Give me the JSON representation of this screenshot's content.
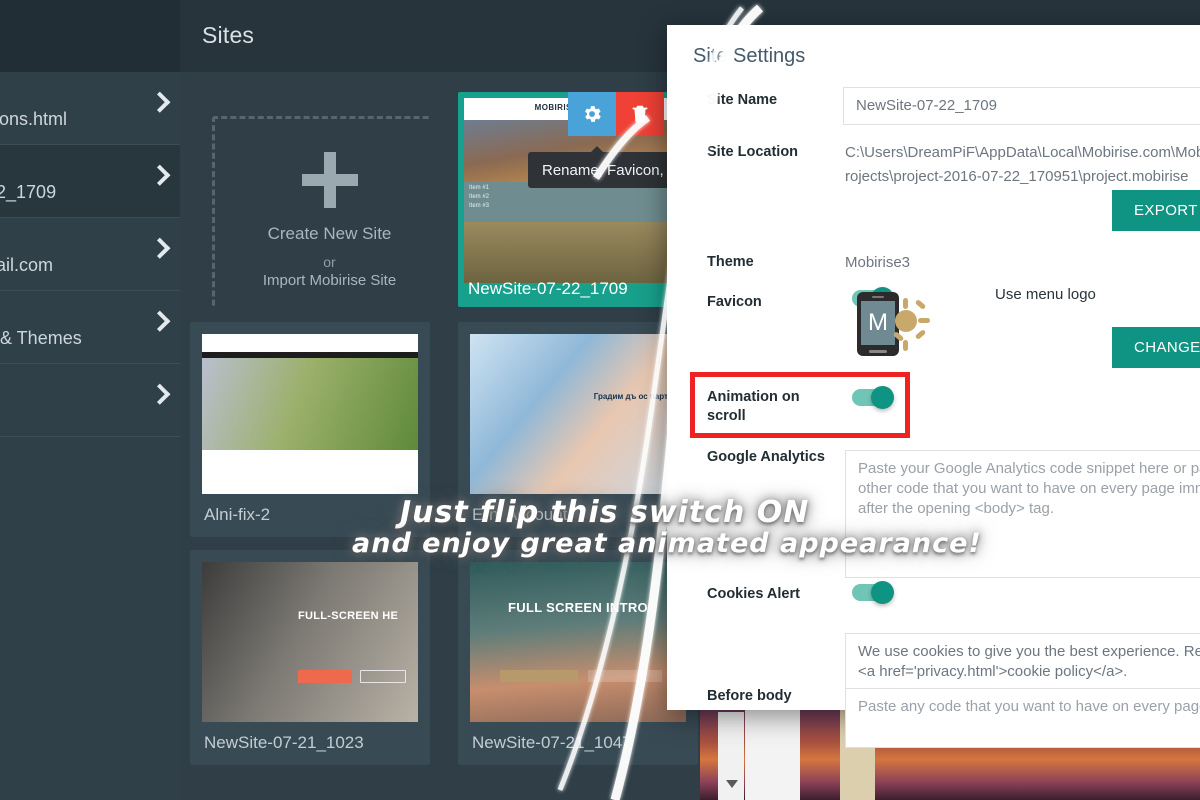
{
  "app": {
    "header_title": "Sites",
    "sidebar": {
      "items": [
        {
          "label": "icons.html",
          "icon": "chevron-right-icon",
          "active": false
        },
        {
          "label": "22_1709",
          "icon": "chevron-right-icon",
          "active": true
        },
        {
          "label": "nail.com",
          "icon": "chevron-right-icon",
          "active": false
        },
        {
          "label": "s & Themes",
          "icon": "chevron-right-icon",
          "active": false
        },
        {
          "label": "",
          "icon": "chevron-right-icon",
          "active": false
        }
      ]
    },
    "new_site": {
      "plus_icon": "plus-icon",
      "create_label": "Create New Site",
      "or_label": "or",
      "import_label": "Import Mobirise Site"
    },
    "tooltip": "Rename, Favicon, E",
    "card_actions": {
      "settings_icon": "gear-icon",
      "delete_icon": "trash-icon"
    },
    "cards": [
      {
        "caption": "NewSite-07-22_1709",
        "selected": true,
        "thumb_text": "MOBIRISE GIVES YO",
        "menu": [
          "Item #1",
          "Item #2",
          "Item #3"
        ]
      },
      {
        "caption": "Alni-fix-2",
        "selected": false,
        "thumb_text": ""
      },
      {
        "caption": "Erni Account",
        "selected": false,
        "thumb_text": "Градим дъ ос парт ьо"
      },
      {
        "caption": "NewSite-07-21_1023",
        "selected": false,
        "thumb_text": "FULL-SCREEN HE"
      },
      {
        "caption": "NewSite-07-21_1047",
        "selected": false,
        "thumb_text": "FULL SCREEN INTRO"
      }
    ]
  },
  "dialog": {
    "title": "Site Settings",
    "site_name": {
      "label": "Site Name",
      "value": "NewSite-07-22_1709"
    },
    "site_location": {
      "label": "Site Location",
      "line1": "C:\\Users\\DreamPiF\\AppData\\Local\\Mobirise.com\\Mobiri",
      "line2": "rojects\\project-2016-07-22_170951\\project.mobirise",
      "export_button": "EXPORT SIT"
    },
    "theme": {
      "label": "Theme",
      "value": "Mobirise3"
    },
    "favicon": {
      "label": "Favicon",
      "art_icon": "phone-favicon-icon",
      "art_letter": "M",
      "use_menu_logo_label": "Use menu logo",
      "use_menu_logo_on": true,
      "change_button": "CHANGE FAVICO"
    },
    "animation_on_scroll": {
      "label_line1": "Animation on",
      "label_line2": "scroll",
      "enabled": true,
      "highlight_color": "#ee2222"
    },
    "google_analytics": {
      "label": "Google Analytics",
      "placeholder": "Paste your Google Analytics code snippet here or paste any other code that you want to have on every page immediately after the opening <body> tag."
    },
    "cookies_alert": {
      "label": "Cookies Alert",
      "enabled": true,
      "value": "We use cookies to give you the best experience. Read ou <a href='privacy.html'>cookie policy</a>."
    },
    "before_body": {
      "label_line1": "Before body",
      "placeholder": "Paste any code that you want to have on every page"
    }
  },
  "annotation": {
    "line1": "Just flip this switch ON",
    "line2": "and enjoy great animated appearance!",
    "pointer_icon": "swoosh-arrow-icon"
  },
  "colors": {
    "accent_teal": "#0f9383",
    "toggle_track": "#6fc6b7",
    "highlight_red": "#ee2222",
    "app_bg": "#2f3e47",
    "sidebar_bg": "#2f4049",
    "topbar_bg": "#27343c",
    "card_bg": "#384a54",
    "selected_card": "#17a08b"
  }
}
